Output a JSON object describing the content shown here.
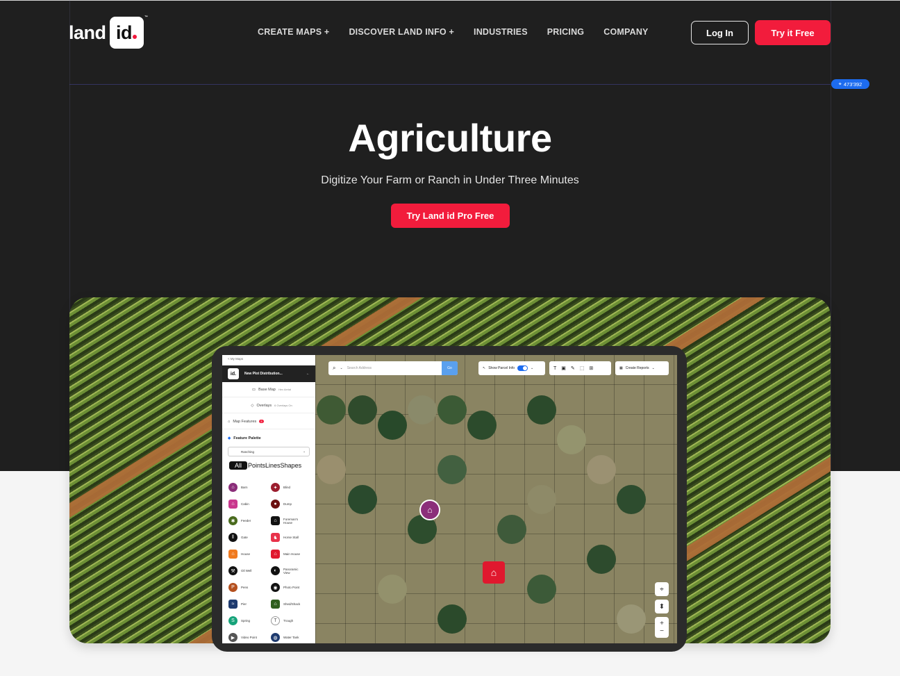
{
  "header": {
    "logo_text": "land",
    "logo_box_text": "id",
    "logo_tm": "™",
    "nav": [
      "CREATE MAPS +",
      "DISCOVER LAND INFO +",
      "INDUSTRIES",
      "PRICING",
      "COMPANY"
    ],
    "login_label": "Log In",
    "try_label": "Try it Free"
  },
  "badge_text": "473'392",
  "hero": {
    "title": "Agriculture",
    "subtitle": "Digitize Your Farm or Ranch in Under Three Minutes",
    "cta_label": "Try Land id Pro Free"
  },
  "app": {
    "back_link": "< My Maps",
    "map_name": "New Plot Distribution...",
    "base_map_label": "Base Map",
    "base_map_value": "Hex Aerial",
    "overlays_label": "Overlays",
    "overlays_value": "6 Overlays On",
    "map_features_label": "Map Features",
    "map_features_count": "3",
    "feature_palette_label": "Feature Palette",
    "palette_select": "Ranching",
    "tabs": [
      "All",
      "Points",
      "Lines",
      "Shapes"
    ],
    "features_left": [
      "Barn",
      "Cabin",
      "Feeder",
      "Gate",
      "House",
      "Oil Well",
      "Pens",
      "Pier",
      "Spring",
      "Video Point"
    ],
    "features_right": [
      "Blind",
      "Dump",
      "Foreman's House",
      "Horse Stall",
      "Main House",
      "Panoramic View",
      "Photo Point",
      "Shed/Shack",
      "Trough",
      "Water Tank"
    ],
    "search_placeholder": "Search Address",
    "search_go": "Go",
    "show_parcel_label": "Show Parcel Info",
    "create_reports_label": "Create Reports"
  },
  "colors": {
    "hero_bg": "#1f1f1f",
    "accent": "#f21c3c",
    "badge": "#1d6cf0"
  }
}
